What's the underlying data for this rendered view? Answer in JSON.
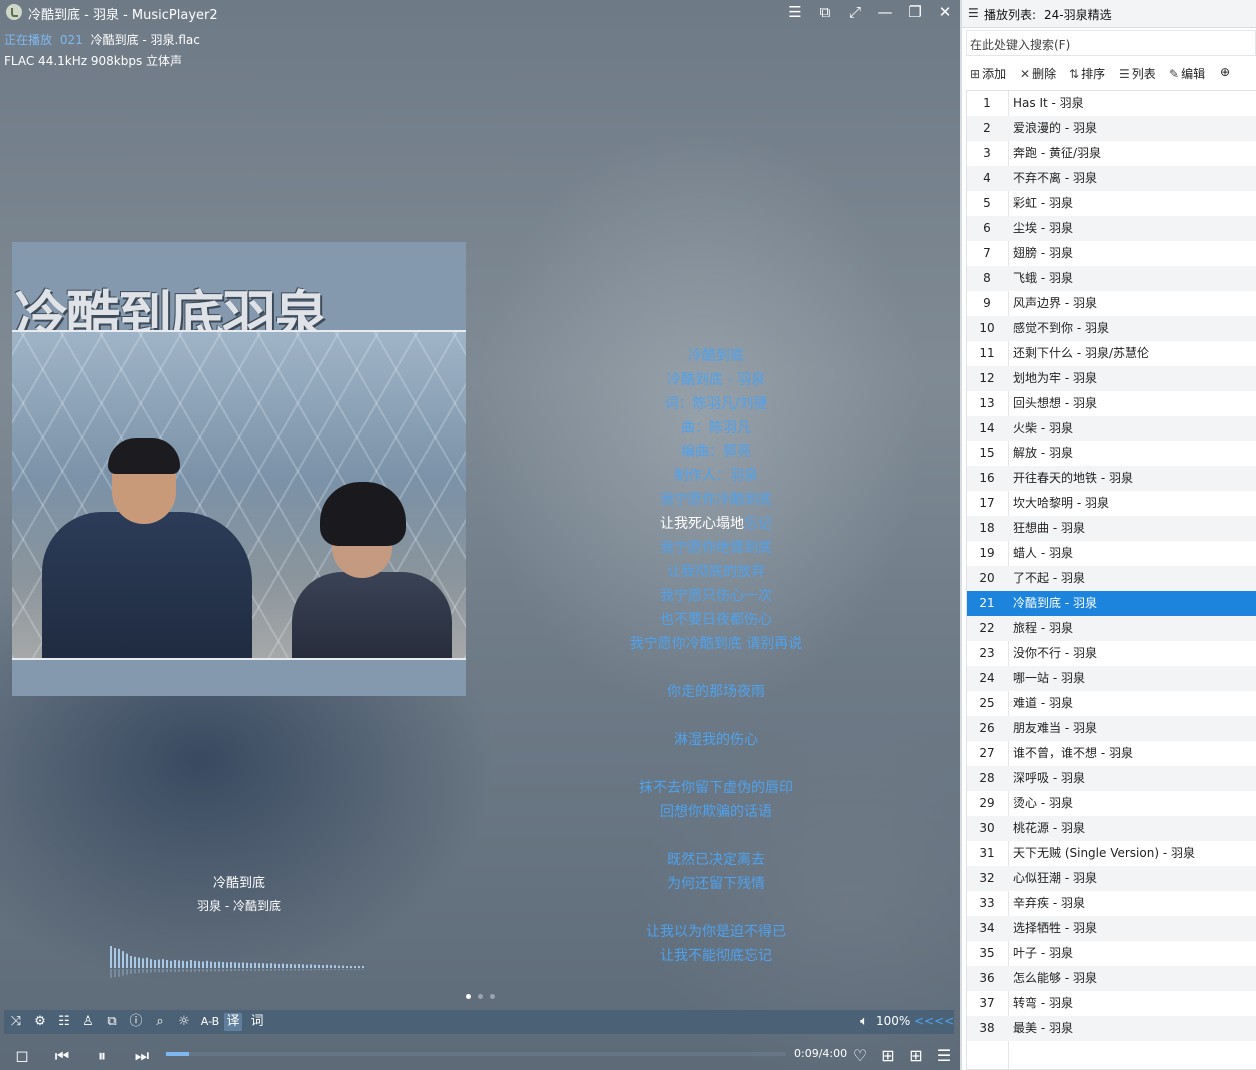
{
  "window": {
    "title": "冷酷到底 - 羽泉 - MusicPlayer2",
    "buttons": [
      "☰",
      "⧉",
      "⤢",
      "—",
      "❐",
      "✕"
    ]
  },
  "now_playing": {
    "label": "正在播放",
    "index": "021",
    "file": "冷酷到底 - 羽泉.flac",
    "format": "FLAC 44.1kHz 908kbps 立体声"
  },
  "album_art": {
    "title_text": "冷酷到底羽泉"
  },
  "song_caption": {
    "title": "冷酷到底",
    "subtitle": "羽泉 - 冷酷到底"
  },
  "lyrics": [
    "冷酷到底",
    "冷酷到底 - 羽泉",
    "词：陈羽凡/刘捷",
    "曲：陈羽凡",
    "编曲：郭亮",
    "制作人：羽泉",
    "我宁愿你冷酷到底",
    "",
    "我宁愿你绝情到底",
    "让我彻底的放弃",
    "我宁愿只伤心一次",
    "也不要日夜都伤心",
    "我宁愿你冷酷到底 请别再说",
    "",
    "你走的那场夜雨",
    "",
    "淋湿我的伤心",
    "",
    "抹不去你留下虚伪的唇印",
    "回想你欺骗的话语",
    "",
    "既然已决定离去",
    "为何还留下残情",
    "",
    "让我以为你是迫不得已",
    "让我不能彻底忘记"
  ],
  "current_lyric": {
    "sung": "让我死心塌地",
    "remain": "忘记"
  },
  "toolbar": {
    "icons": [
      "shuffle-icon",
      "settings-icon",
      "equalizer-icon",
      "skin-icon",
      "mini-mode-icon",
      "info-icon",
      "search-icon",
      "brightness-icon"
    ],
    "ab_label": "A-B",
    "translate_label": "译",
    "lyric_label": "词",
    "volume": "100%",
    "speed": "<<<<"
  },
  "playback": {
    "time": "0:09/4:00",
    "progress": 0.0375
  },
  "playlist": {
    "header_label": "播放列表:",
    "name": "24-羽泉精选",
    "search_placeholder": "在此处键入搜索(F)",
    "tools": [
      "添加",
      "删除",
      "排序",
      "列表",
      "编辑"
    ],
    "selected_index": 21,
    "items": [
      "Has It - 羽泉",
      "爱浪漫的 - 羽泉",
      "奔跑 - 黄征/羽泉",
      "不弃不离 - 羽泉",
      "彩虹 - 羽泉",
      "尘埃 - 羽泉",
      "翅膀 - 羽泉",
      "飞蛾 - 羽泉",
      "风声边界 - 羽泉",
      "感觉不到你 - 羽泉",
      "还剩下什么 - 羽泉/苏慧伦",
      "划地为牢 - 羽泉",
      "回头想想 - 羽泉",
      "火柴 - 羽泉",
      "解放 - 羽泉",
      "开往春天的地铁 - 羽泉",
      "坎大哈黎明 - 羽泉",
      "狂想曲 - 羽泉",
      "蜡人 - 羽泉",
      "了不起 - 羽泉",
      "冷酷到底 - 羽泉",
      "旅程 - 羽泉",
      "没你不行 - 羽泉",
      "哪一站 - 羽泉",
      "难道 - 羽泉",
      "朋友难当 - 羽泉",
      "谁不曾，谁不想 - 羽泉",
      "深呼吸 - 羽泉",
      "烫心 - 羽泉",
      "桃花源 - 羽泉",
      "天下无贼 (Single Version) - 羽泉",
      "心似狂潮 - 羽泉",
      "辛弃疾 - 羽泉",
      "选择牺牲 - 羽泉",
      "叶子 - 羽泉",
      "怎么能够 - 羽泉",
      "转弯 - 羽泉",
      "最美 - 羽泉"
    ]
  },
  "colors": {
    "accent": "#4ea2ee",
    "selected_row": "#1c84dc",
    "toolbar": "#4b6276"
  },
  "spectrum_levels": [
    0.55,
    0.5,
    0.48,
    0.42,
    0.36,
    0.3,
    0.28,
    0.26,
    0.24,
    0.26,
    0.22,
    0.2,
    0.21,
    0.22,
    0.2,
    0.18,
    0.2,
    0.19,
    0.18,
    0.17,
    0.2,
    0.18,
    0.17,
    0.16,
    0.18,
    0.16,
    0.15,
    0.16,
    0.15,
    0.14,
    0.15,
    0.14,
    0.13,
    0.14,
    0.13,
    0.12,
    0.13,
    0.12,
    0.12,
    0.11,
    0.12,
    0.11,
    0.1,
    0.11,
    0.1,
    0.1,
    0.09,
    0.1,
    0.09,
    0.08,
    0.09,
    0.08,
    0.08,
    0.07,
    0.08,
    0.07,
    0.07,
    0.06,
    0.06,
    0.05,
    0.05,
    0.05,
    0.04,
    0.04
  ]
}
